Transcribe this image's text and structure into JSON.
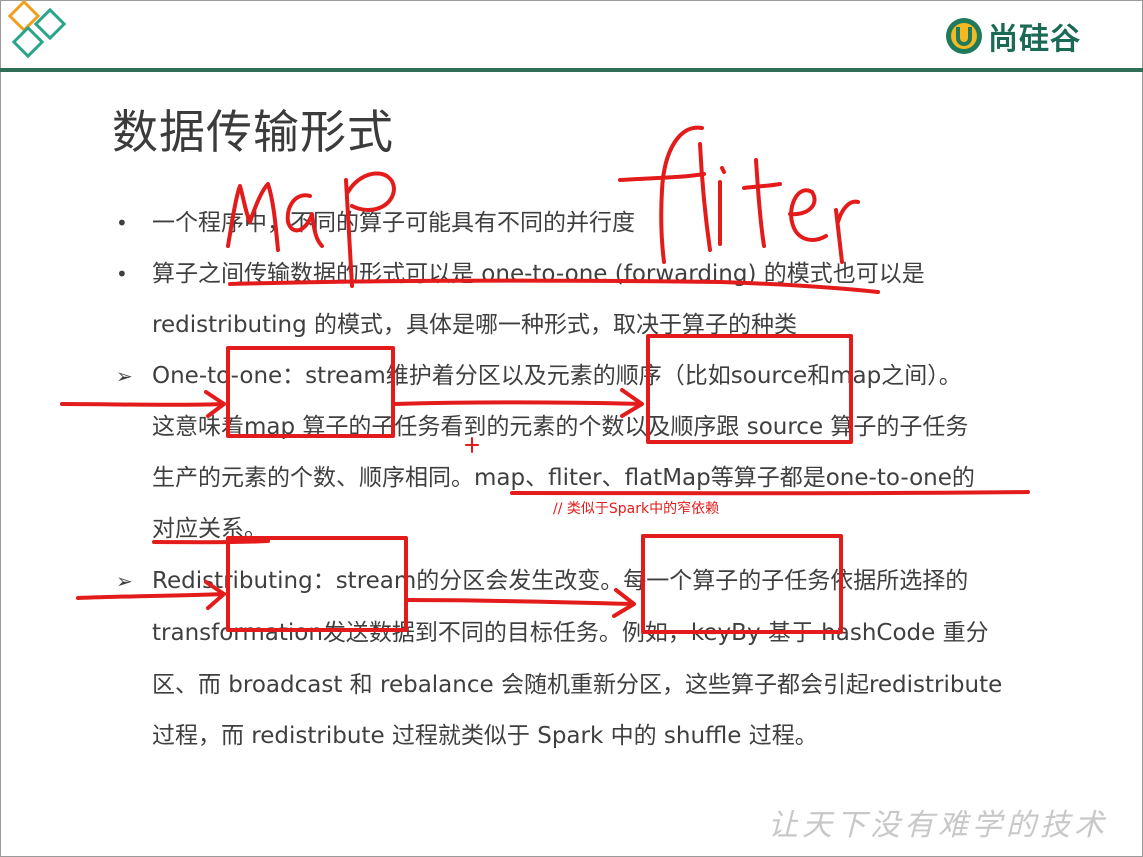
{
  "brand": {
    "name": "尚硅谷"
  },
  "title": "数据传输形式",
  "bullets": [
    "一个程序中，不同的算子可能具有不同的并行度",
    "算子之间传输数据的形式可以是 one-to-one (forwarding) 的模式也可以是",
    "redistributing 的模式，具体是哪一种形式，取决于算子的种类"
  ],
  "one_to_one": {
    "bullet": "➢",
    "lines": [
      "One-to-one：stream维护着分区以及元素的顺序（比如source和map之间）。",
      "这意味着map 算子的子任务看到的元素的个数以及顺序跟 source 算子的子任务",
      "生产的元素的个数、顺序相同。map、fliter、flatMap等算子都是one-to-one的",
      "对应关系。"
    ]
  },
  "redistributing": {
    "bullet": "➢",
    "lines": [
      "Redistributing：stream的分区会发生改变。每一个算子的子任务依据所选择的",
      "transformation发送数据到不同的目标任务。例如，keyBy 基于 hashCode 重分",
      "区、而 broadcast 和 rebalance 会随机重新分区，这些算子都会引起redistribute",
      "过程，而 redistribute 过程就类似于 Spark 中的 shuffle 过程。"
    ]
  },
  "annotations": {
    "handwritten_map": "map",
    "handwritten_fliter": "fliter",
    "note": "// 类似于Spark中的窄依赖",
    "ink_color": "#e41b1b"
  },
  "watermark": "让天下没有难学的技术"
}
